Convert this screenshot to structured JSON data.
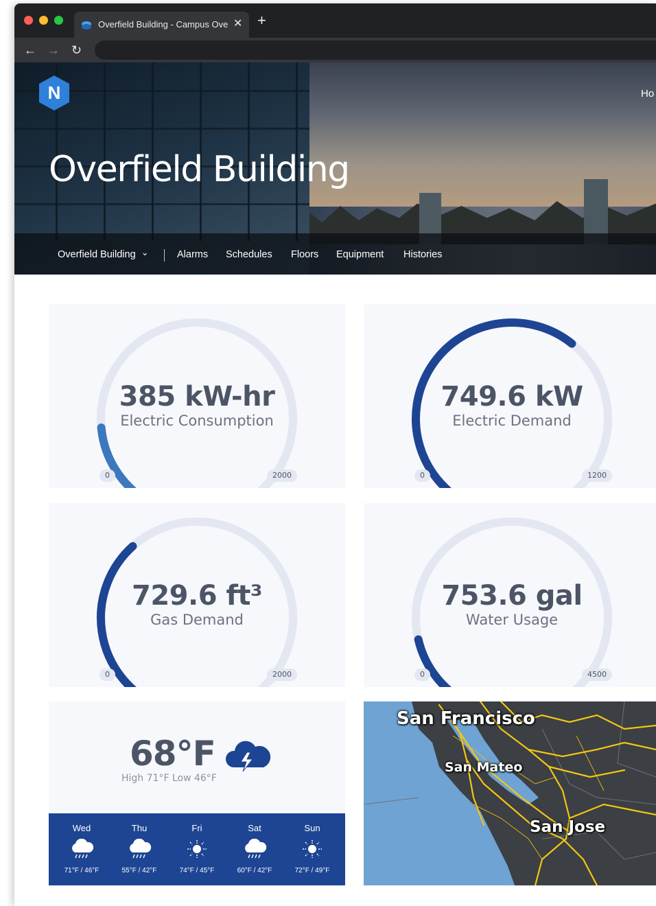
{
  "browser": {
    "tab_title": "Overfield Building - Campus Overview",
    "close_glyph": "✕",
    "new_tab_glyph": "+",
    "back_glyph": "←",
    "forward_glyph": "→",
    "reload_glyph": "↻"
  },
  "header": {
    "logo_letter": "N",
    "title": "Overfield Building",
    "top_link": "Ho"
  },
  "subnav": {
    "building": "Overfield Building",
    "chevron": "⌄",
    "items": [
      "Alarms",
      "Schedules",
      "Floors",
      "Equipment",
      "Histories"
    ]
  },
  "gauges": [
    {
      "value": "385 kW-hr",
      "label": "Electric Consumption",
      "min": "0",
      "max": "2000",
      "level": 0.1925,
      "color": "#3d78bd"
    },
    {
      "value": "749.6 kW",
      "label": "Electric Demand",
      "min": "0",
      "max": "1200",
      "level": 0.6247,
      "color": "#1e4593"
    },
    {
      "value": "729.6 ft³",
      "label": "Gas Demand",
      "min": "0",
      "max": "2000",
      "level": 0.3648,
      "color": "#1e4593"
    },
    {
      "value": "753.6 gal",
      "label": "Water Usage",
      "min": "0",
      "max": "4500",
      "level": 0.1675,
      "color": "#1e4593"
    }
  ],
  "weather": {
    "temperature": "68°F",
    "high_low": "High 71°F Low 46°F",
    "current_icon": "thunderstorm-icon",
    "forecast": [
      {
        "day": "Wed",
        "icon": "rain-cloud-icon",
        "range": "71°F / 46°F"
      },
      {
        "day": "Thu",
        "icon": "rain-cloud-icon",
        "range": "55°F / 42°F"
      },
      {
        "day": "Fri",
        "icon": "sun-icon",
        "range": "74°F / 45°F"
      },
      {
        "day": "Sat",
        "icon": "rain-cloud-icon",
        "range": "60°F / 42°F"
      },
      {
        "day": "Sun",
        "icon": "sun-icon",
        "range": "72°F / 49°F"
      }
    ]
  },
  "map": {
    "cities": [
      "San Francisco",
      "San Mateo",
      "San Jose"
    ]
  },
  "colors": {
    "accent": "#1e4593",
    "gauge_track": "#e3e7f1",
    "card_bg": "#f7f8fc",
    "water": "#6fa3d3",
    "land": "#3c3f44",
    "roads": "#f3c613"
  }
}
